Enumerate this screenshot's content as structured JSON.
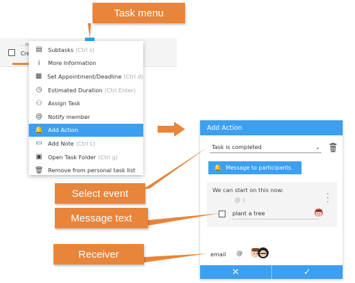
{
  "callouts": {
    "task_menu": "Task menu",
    "select_event": "Select event",
    "message_text": "Message text",
    "receiver": "Receiver"
  },
  "task_row": {
    "meta": "-- PM",
    "label": "Cre"
  },
  "menu": {
    "items": [
      {
        "icon": "subtasks-icon",
        "glyph": "▤",
        "label": "Subtasks",
        "shortcut": "(Ctrl s)"
      },
      {
        "icon": "info-icon",
        "glyph": "i",
        "label": "More Information",
        "shortcut": ""
      },
      {
        "icon": "calendar-icon",
        "glyph": "▦",
        "label": "Set Appointment/Deadline",
        "shortcut": "(Ctrl d)"
      },
      {
        "icon": "clock-icon",
        "glyph": "◷",
        "label": "Estimated Duration",
        "shortcut": "(Ctrl Enter)"
      },
      {
        "icon": "assign-user-icon",
        "glyph": "⚇",
        "label": "Assign Task",
        "shortcut": ""
      },
      {
        "icon": "at-icon",
        "glyph": "@",
        "label": "Notify member",
        "shortcut": ""
      },
      {
        "icon": "bell-icon",
        "glyph": "🔔",
        "label": "Add Action",
        "shortcut": ""
      },
      {
        "icon": "note-icon",
        "glyph": "▭",
        "label": "Add Note",
        "shortcut": "(Ctrl L)"
      },
      {
        "icon": "folder-icon",
        "glyph": "▣",
        "label": "Open Task Folder",
        "shortcut": "(Ctrl g)"
      },
      {
        "icon": "trash-icon",
        "glyph": "🗑",
        "label": "Remove from personal task list",
        "shortcut": ""
      }
    ],
    "active_index": 6
  },
  "panel": {
    "title": "Add Action",
    "event_value": "Task is completed",
    "message_button": "Message to participants",
    "message_text": "We can start on this now:",
    "mention_count": "1",
    "task_item": "plant a tree",
    "receiver_label": "email",
    "receiver_at": "@",
    "cancel_glyph": "✕",
    "confirm_glyph": "✓"
  },
  "colors": {
    "accent_blue": "#3d9ff0",
    "callout_orange": "#e8853a"
  }
}
